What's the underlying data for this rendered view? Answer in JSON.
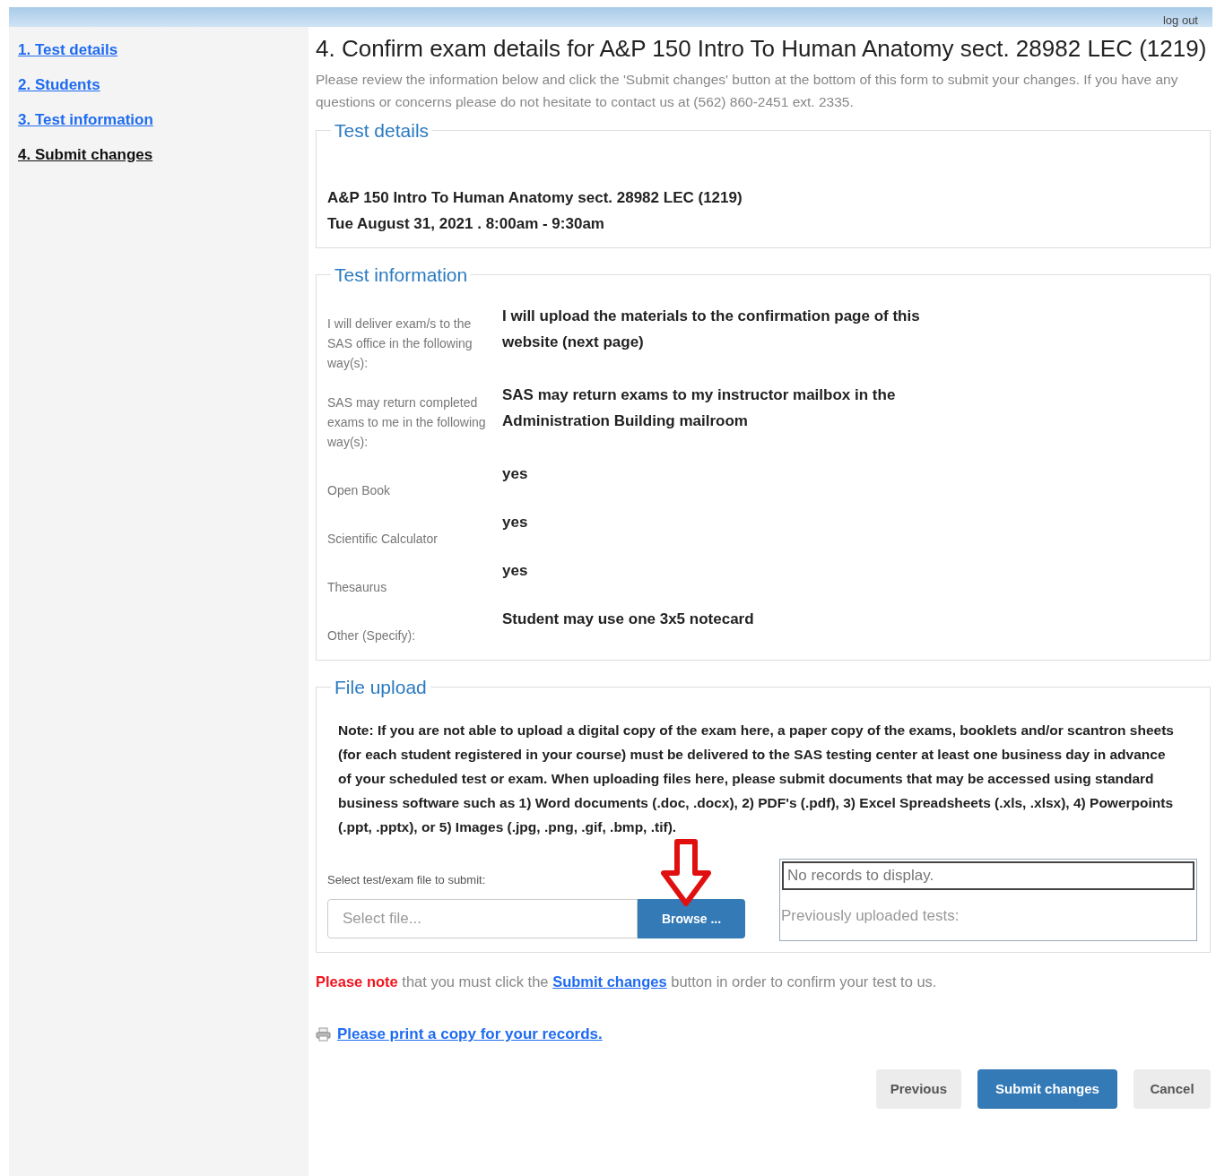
{
  "top_bar": {
    "logout": "log out"
  },
  "sidebar": {
    "items": [
      {
        "label": "1. Test details",
        "selected": false
      },
      {
        "label": "2. Students",
        "selected": false
      },
      {
        "label": "3. Test information",
        "selected": false
      },
      {
        "label": "4. Submit changes",
        "selected": true
      }
    ]
  },
  "heading": "4. Confirm exam details for A&P 150 Intro To Human Anatomy sect. 28982 LEC (1219)",
  "intro": "Please review the information below and click the 'Submit changes' button at the bottom of this form to submit your changes. If you have any questions or concerns please do not hesitate to contact us at (562) 860-2451 ext. 2335.",
  "test_details": {
    "legend": "Test details",
    "course": "A&P 150 Intro To Human Anatomy sect. 28982 LEC (1219)",
    "date": "Tue August 31, 2021 . 8:00am - 9:30am"
  },
  "test_information": {
    "legend": "Test information",
    "rows": [
      {
        "label": "I will deliver exam/s to the SAS office in the following way(s):",
        "value": "I will upload the materials to the confirmation page of this website (next page)"
      },
      {
        "label": "SAS may return completed exams to me in the following way(s):",
        "value": "SAS may return exams to my instructor mailbox in the Administration Building mailroom"
      },
      {
        "label": "Open Book",
        "value": "yes"
      },
      {
        "label": "Scientific Calculator",
        "value": "yes"
      },
      {
        "label": "Thesaurus",
        "value": "yes"
      },
      {
        "label": "Other (Specify):",
        "value": "Student may use one 3x5 notecard"
      }
    ]
  },
  "file_upload": {
    "legend": "File upload",
    "note": "Note: If you are not able to upload a digital copy of the exam here, a paper copy of the exams, booklets and/or scantron sheets (for each student registered in your course) must be delivered to the SAS testing center at least one business day in advance of your scheduled test or exam. When uploading files here, please submit documents that may be accessed using standard business software such as 1) Word documents (.doc, .docx), 2) PDF's (.pdf), 3) Excel Spreadsheets (.xls, .xlsx), 4) Powerpoints (.ppt, .pptx), or 5) Images (.jpg, .png, .gif, .bmp, .tif).",
    "select_label": "Select test/exam file to submit:",
    "file_placeholder": "Select file...",
    "browse": "Browse ...",
    "empty": "No records to display.",
    "previous_label": "Previously uploaded tests:"
  },
  "notice": {
    "highlight": "Please note",
    "before_link": "that you must click the",
    "link": "Submit changes",
    "after_link": "button in order to confirm your test to us."
  },
  "print_link": "Please print a copy for your records.",
  "buttons": [
    {
      "label": "Previous",
      "kind": "secondary"
    },
    {
      "label": "Submit changes",
      "kind": "primary"
    },
    {
      "label": "Cancel",
      "kind": "secondary"
    }
  ]
}
